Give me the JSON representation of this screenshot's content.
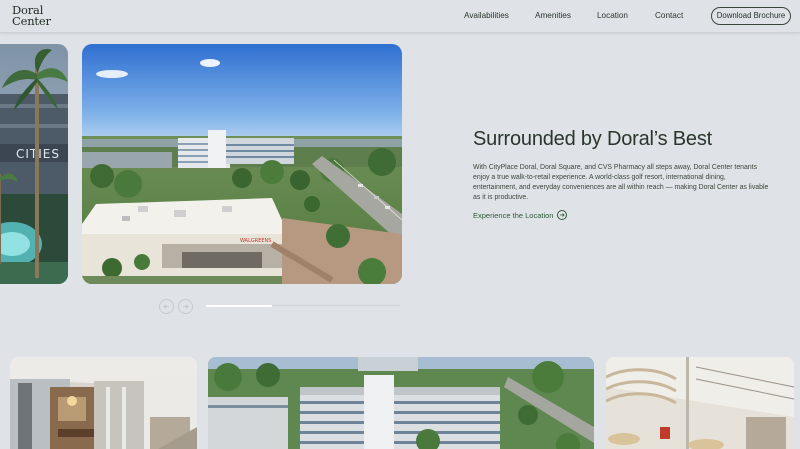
{
  "header": {
    "logo_line1": "Doral",
    "logo_line2": "Center",
    "nav": {
      "availabilities": "Availabilities",
      "amenities": "Amenities",
      "location": "Location",
      "contact": "Contact"
    },
    "brochure_button": "Download Brochure"
  },
  "hero": {
    "title": "Surrounded by Doral’s Best",
    "body": "With CityPlace Doral, Doral Square, and CVS Pharmacy all steps away, Doral Center tenants enjoy a true walk-to-retail experience. A world-class golf resort, international dining, entertainment, and everyday conveniences are all within reach — making Doral Center as livable as it is productive.",
    "link": "Experience the Location",
    "prev_slide_sign": "CITIES",
    "building_sign": "WALGREENS"
  },
  "carousel": {
    "progress_fraction": 0.34
  },
  "icons": {
    "prev": "arrow-left-icon",
    "next": "arrow-right-icon",
    "link_arrow": "arrow-right-circle-icon"
  },
  "colors": {
    "background": "#dfe3e7",
    "accent_green": "#2c5a36",
    "text_dark": "#27332a"
  }
}
